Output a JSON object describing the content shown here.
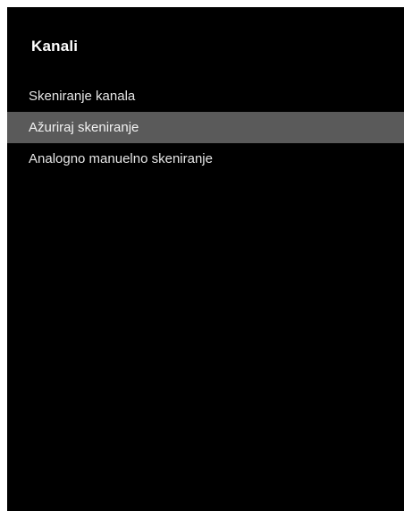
{
  "menu": {
    "title": "Kanali",
    "items": [
      {
        "label": "Skeniranje kanala",
        "selected": false
      },
      {
        "label": "Ažuriraj skeniranje",
        "selected": true
      },
      {
        "label": "Analogno manuelno skeniranje",
        "selected": false
      }
    ]
  },
  "colors": {
    "background": "#000000",
    "highlight": "#5a5a5a",
    "text": "#e6e6e6"
  }
}
